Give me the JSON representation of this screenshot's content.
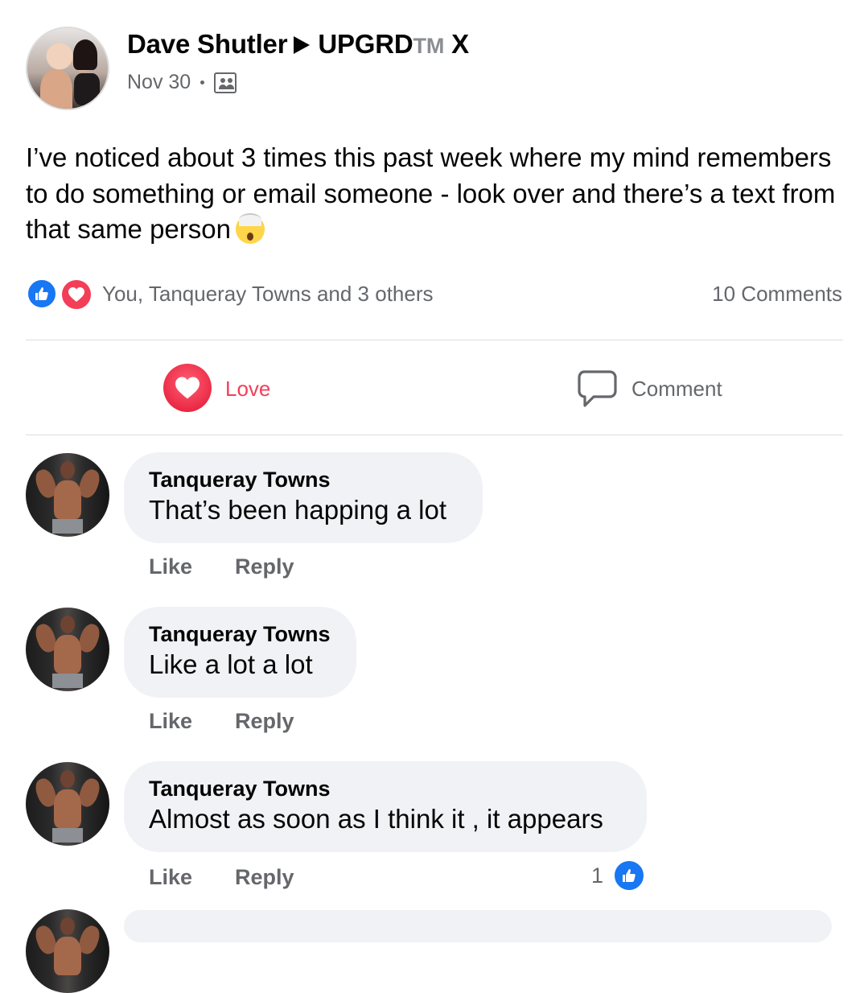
{
  "post": {
    "author": "Dave Shutler",
    "group": "UPGRD",
    "group_tm": "TM",
    "group_suffix": "X",
    "date": "Nov 30",
    "text": "I’ve noticed about 3 times this past week where my mind remembers to do something or email someone - look over and there’s a text from that same person",
    "emoji": "exploding-head-emoji"
  },
  "reactions": {
    "summary": "You, Tanqueray Towns and 3 others",
    "comments_count": "10 Comments",
    "colors": {
      "like": "#1877f2",
      "love": "#f33e58"
    }
  },
  "actions": {
    "love_label": "Love",
    "comment_label": "Comment"
  },
  "comments": [
    {
      "author": "Tanqueray Towns",
      "text": "That’s been happing a lot",
      "like": "Like",
      "reply": "Reply"
    },
    {
      "author": "Tanqueray Towns",
      "text": "Like a lot a lot",
      "like": "Like",
      "reply": "Reply"
    },
    {
      "author": "Tanqueray Towns",
      "text": "Almost as soon as I think it , it appears",
      "like": "Like",
      "reply": "Reply",
      "like_count": "1"
    }
  ]
}
